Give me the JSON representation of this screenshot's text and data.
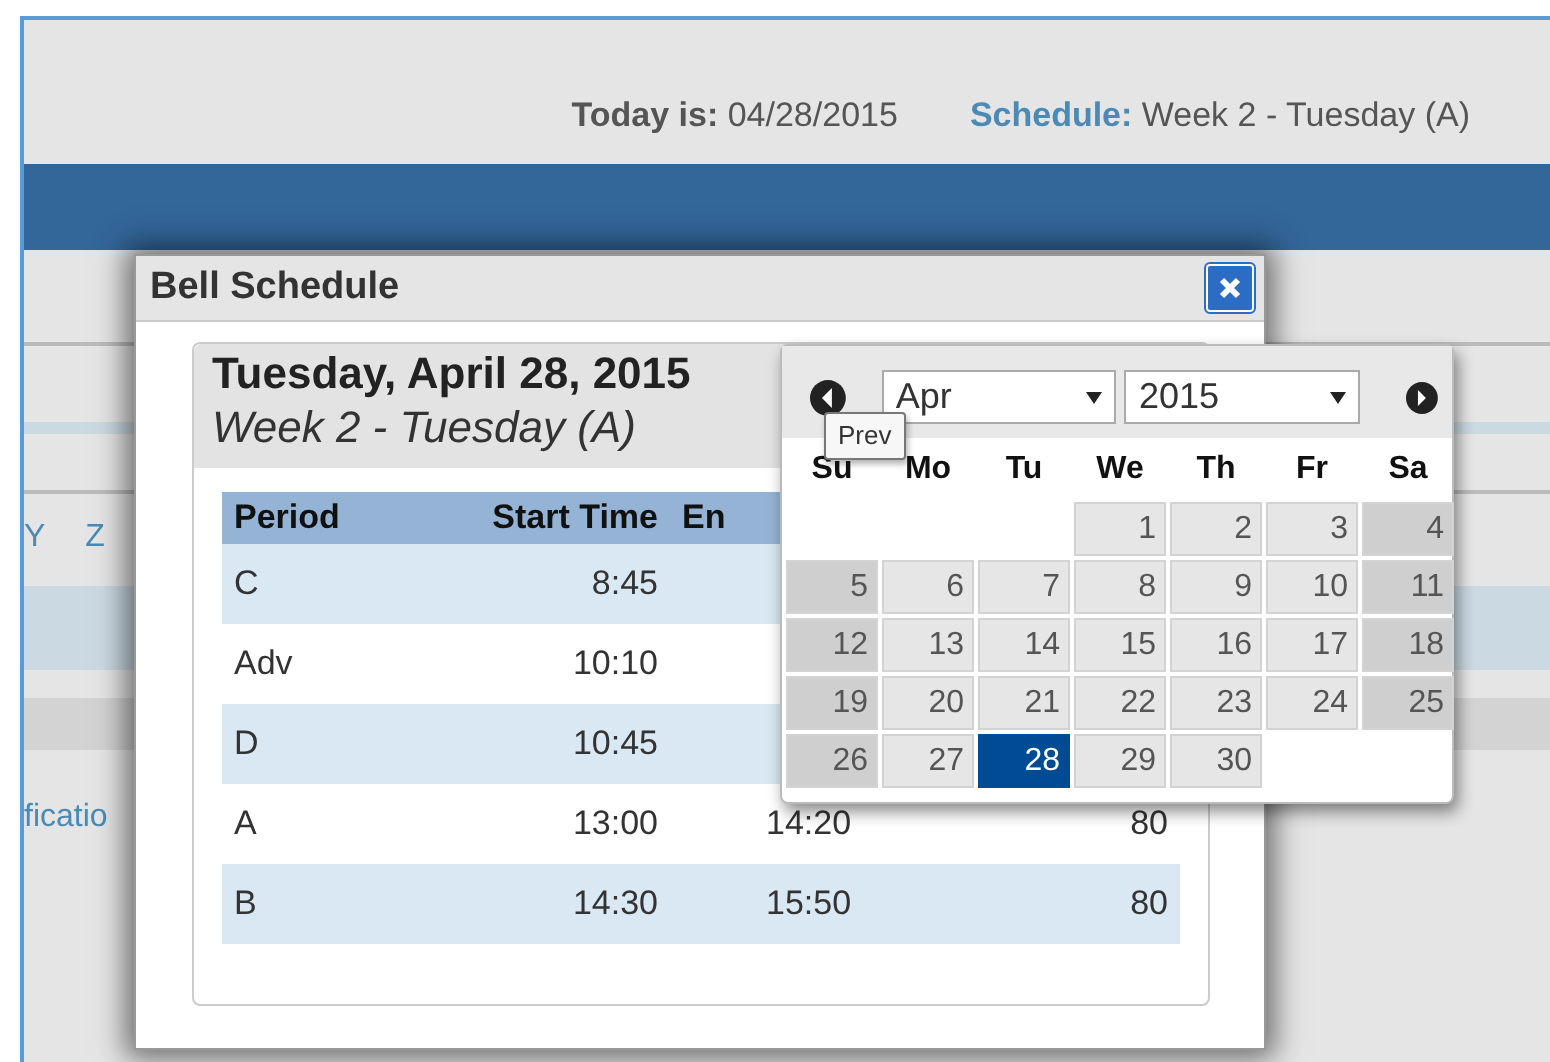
{
  "header": {
    "today_label": "Today is:",
    "today_value": "04/28/2015",
    "schedule_label": "Schedule:",
    "schedule_value": "Week 2 - Tuesday (A)"
  },
  "background": {
    "letters": [
      "Y",
      "Z"
    ],
    "link": "ficatio"
  },
  "dialog": {
    "title": "Bell Schedule"
  },
  "schedule": {
    "date": "Tuesday, April 28, 2015",
    "week": "Week 2 - Tuesday (A)",
    "columns": [
      "Period",
      "Start Time",
      "En"
    ],
    "rows": [
      [
        "C",
        "8:45"
      ],
      [
        "Adv",
        "10:10"
      ],
      [
        "D",
        "10:45"
      ],
      [
        "A",
        "13:00",
        "14:20",
        "80"
      ],
      [
        "B",
        "14:30",
        "15:50",
        "80"
      ]
    ]
  },
  "datepicker": {
    "month": "Apr",
    "year": "2015",
    "tooltip": "Prev",
    "weekdays": [
      "Su",
      "Mo",
      "Tu",
      "We",
      "Th",
      "Fr",
      "Sa"
    ],
    "weeks": [
      {
        "kind": "first",
        "days": [
          {
            "label": "1",
            "selected": false
          },
          {
            "label": "2",
            "selected": false
          },
          {
            "label": "3",
            "selected": false
          },
          {
            "label": "4",
            "selected": false
          }
        ]
      },
      {
        "kind": "full",
        "days": [
          {
            "label": "5",
            "selected": false
          },
          {
            "label": "6",
            "selected": false
          },
          {
            "label": "7",
            "selected": false
          },
          {
            "label": "8",
            "selected": false
          },
          {
            "label": "9",
            "selected": false
          },
          {
            "label": "10",
            "selected": false
          },
          {
            "label": "11",
            "selected": false
          }
        ]
      },
      {
        "kind": "full",
        "days": [
          {
            "label": "12",
            "selected": false
          },
          {
            "label": "13",
            "selected": false
          },
          {
            "label": "14",
            "selected": false
          },
          {
            "label": "15",
            "selected": false
          },
          {
            "label": "16",
            "selected": false
          },
          {
            "label": "17",
            "selected": false
          },
          {
            "label": "18",
            "selected": false
          }
        ]
      },
      {
        "kind": "full",
        "days": [
          {
            "label": "19",
            "selected": false
          },
          {
            "label": "20",
            "selected": false
          },
          {
            "label": "21",
            "selected": false
          },
          {
            "label": "22",
            "selected": false
          },
          {
            "label": "23",
            "selected": false
          },
          {
            "label": "24",
            "selected": false
          },
          {
            "label": "25",
            "selected": false
          }
        ]
      },
      {
        "kind": "last",
        "days": [
          {
            "label": "26",
            "selected": false
          },
          {
            "label": "27",
            "selected": false
          },
          {
            "label": "28",
            "selected": true
          },
          {
            "label": "29",
            "selected": false
          },
          {
            "label": "30",
            "selected": false
          }
        ]
      }
    ]
  }
}
